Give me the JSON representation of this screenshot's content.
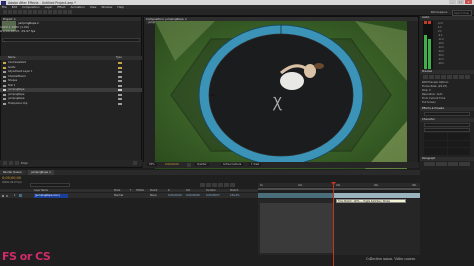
{
  "window": {
    "title": "Adobe After Effects - Untitled Project.aep *"
  },
  "menu": [
    "File",
    "Edit",
    "Composition",
    "Layer",
    "Effect",
    "Animation",
    "View",
    "Window",
    "Help"
  ],
  "workspace": {
    "label": "Workspace:",
    "search_placeholder": "Search Help"
  },
  "project": {
    "tab": "Project ×",
    "selected_item": "jumpingRope ▾",
    "info_line1": "1920 x 1080 (1.00)",
    "info_line2": "Δ 0;00;08;07, 29.97 fps",
    "columns": {
      "name": "Name",
      "type": "Type"
    },
    "items": [
      {
        "label": "ClockwiseShot",
        "color": "#c7a64b",
        "selected": false
      },
      {
        "label": "Solids",
        "color": "#c7a64b",
        "selected": false
      },
      {
        "label": "Adjustment Layer 1",
        "color": "#9d9d9d",
        "selected": false
      },
      {
        "label": "CheckerBoard",
        "color": "#9d9d9d",
        "selected": false
      },
      {
        "label": "Shapes",
        "color": "#9d9d9d",
        "selected": false
      },
      {
        "label": "Null 1",
        "color": "#9d9d9d",
        "selected": false
      },
      {
        "label": "jumpingRope",
        "color": "#d0d0d0",
        "selected": true
      },
      {
        "label": "jumpingRope",
        "color": "#9d9d9d",
        "selected": false
      },
      {
        "label": "jumpingRope",
        "color": "#9d9d9d",
        "selected": false
      },
      {
        "label": "Trampoline Clip",
        "color": "#9d9d9d",
        "selected": false
      }
    ],
    "footer_bpc": "8 bpc"
  },
  "viewer": {
    "tab": "Composition: jumpingRope ×",
    "comp_name": "jumpingRope",
    "zoom": "25%",
    "time": "0;00;00;00",
    "quality": "Quarter",
    "view": "Active Camera",
    "views": "1 View"
  },
  "right_panel": {
    "preview_tab": "Preview",
    "effects_tab": "Effects & Presets",
    "character_tab": "Character",
    "paragraph_tab": "Paragraph",
    "rows": [
      "RAM Preview Options",
      "Frame Rate: (29.97)",
      "Skip: 0",
      "Resolution: Auto",
      "From Current Time",
      "Full Screen"
    ]
  },
  "timeline": {
    "tabs": [
      "Render Queue",
      "jumpingRope ×"
    ],
    "current_time": "0;00;00;00",
    "fps": "00000 (29.97 fps)",
    "columns": [
      "Layer Name",
      "Mode",
      "T",
      "TrkMat",
      "Parent",
      "In",
      "Out",
      "Duration",
      "Stretch"
    ],
    "layer": {
      "num": "1",
      "name": "[jumpingRope.mov]",
      "mode": "Normal",
      "parent": "None",
      "in": "0;00;00;00",
      "out": "0;00;08;06",
      "duration": "0;00;08;07",
      "stretch": "100.0%"
    },
    "ruler_marks": [
      "0s",
      "02s",
      "04s",
      "06s",
      "08s"
    ],
    "tooltip": "Time Stretch: 100% — Toggle Switches / Modes"
  },
  "watermark": "FS or CS",
  "credit": "Collective union. Video course."
}
